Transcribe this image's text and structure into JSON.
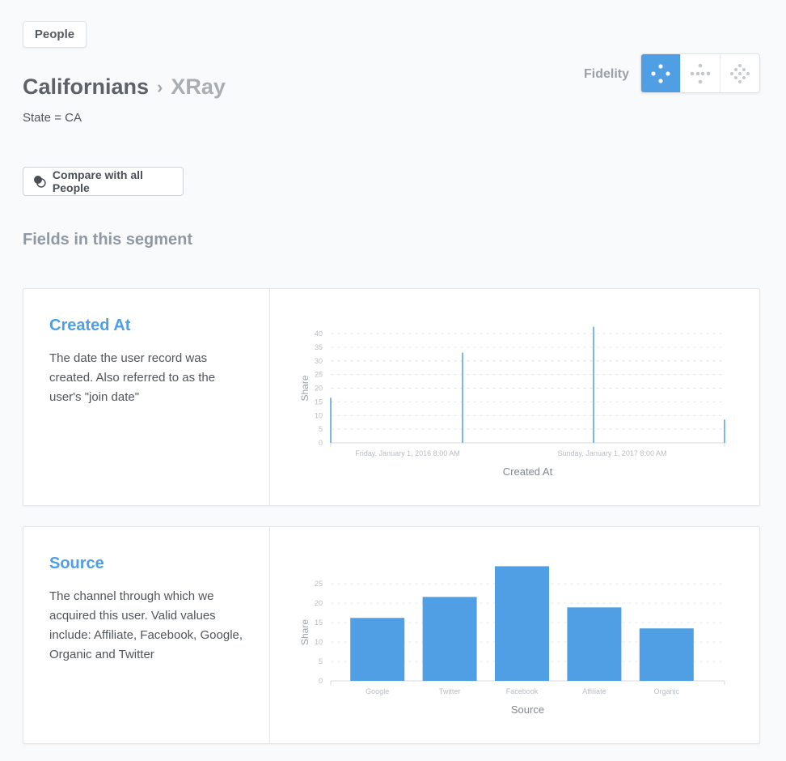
{
  "top_button": {
    "label": "People"
  },
  "breadcrumb": {
    "primary": "Californians",
    "separator": "›",
    "secondary": "XRay"
  },
  "filter": {
    "text": "State = CA"
  },
  "fidelity": {
    "label": "Fidelity",
    "options": [
      "low-fidelity-icon",
      "medium-fidelity-icon",
      "high-fidelity-icon"
    ],
    "selected": 0
  },
  "compare_button": {
    "label": "Compare with all People",
    "icon": "compare-circles-icon"
  },
  "section": {
    "title": "Fields in this segment"
  },
  "colors": {
    "accent": "#509ee3",
    "grid": "#e6e9ec",
    "axis_text": "#b8bdc2"
  },
  "cards": [
    {
      "title": "Created At",
      "description": "The date the user record was created. Also referred to as the user's \"join date\""
    },
    {
      "title": "Source",
      "description": "The channel through which we acquired this user. Valid values include: Affiliate, Facebook, Google, Organic and Twitter"
    }
  ],
  "chart_data": [
    {
      "type": "bar",
      "title": "",
      "xlabel": "Created At",
      "ylabel": "Share",
      "ylim": [
        0,
        40
      ],
      "yticks": [
        0,
        5,
        10,
        15,
        20,
        25,
        30,
        35,
        40
      ],
      "x_tick_labels": [
        "Friday, January 1, 2016 8:00 AM",
        "Sunday, January 1, 2017 8:00 AM"
      ],
      "x": [
        "2015",
        "2016",
        "2017",
        "2018"
      ],
      "values": [
        16.5,
        33,
        42.5,
        8.5
      ],
      "grid": true
    },
    {
      "type": "bar",
      "title": "",
      "xlabel": "Source",
      "ylabel": "Share",
      "ylim": [
        0,
        25
      ],
      "yticks": [
        0,
        5,
        10,
        15,
        20,
        25
      ],
      "categories": [
        "Google",
        "Twitter",
        "Facebook",
        "Affiliate",
        "Organic"
      ],
      "values": [
        16.2,
        21.6,
        29.5,
        18.9,
        13.5
      ],
      "grid": true
    }
  ]
}
